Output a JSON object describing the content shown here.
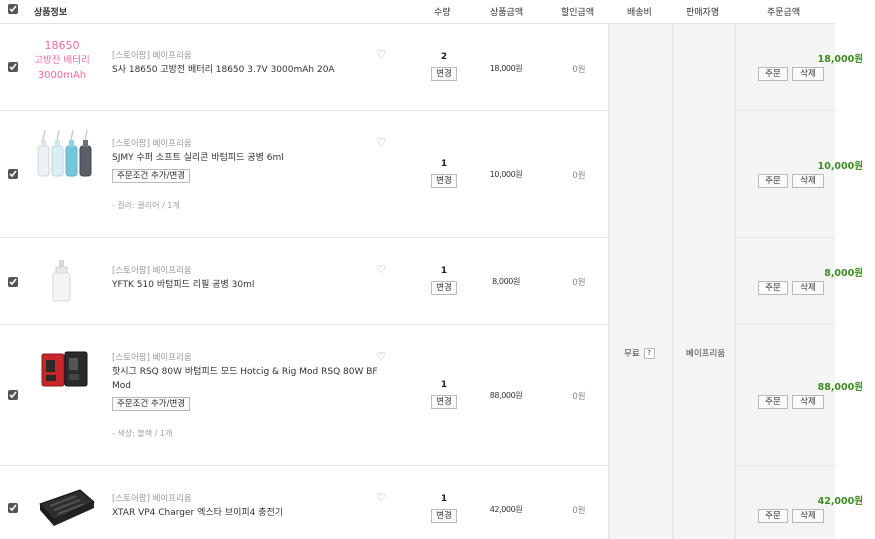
{
  "header": {
    "product_info": "상품정보",
    "quantity": "수량",
    "price": "상품금액",
    "discount": "할인금액",
    "shipping": "배송비",
    "seller": "판매자명",
    "order_total": "주문금액"
  },
  "shipping": {
    "label": "무료",
    "help": "?"
  },
  "seller": {
    "name": "베이프리움"
  },
  "buttons": {
    "change": "변경",
    "order": "주문",
    "delete": "삭제"
  },
  "items": [
    {
      "store": "[스토어팜] 베이프리움",
      "name": "S사 18650 고방전 배터리 18650 3.7V 3000mAh 20A",
      "thumb_lines": [
        "18650",
        "고방전 배터리",
        "3000mAh"
      ],
      "qty": "2",
      "price": "18,000원",
      "discount": "0원",
      "total": "18,000원"
    },
    {
      "store": "[스토어팜] 베이프리움",
      "name": "SJMY 수퍼 소프트 실리콘 바텀피드 공병 6ml",
      "option_button": "주문조건 추가/변경",
      "option_info": "- 컬러: 클리어 / 1개",
      "qty": "1",
      "price": "10,000원",
      "discount": "0원",
      "total": "10,000원"
    },
    {
      "store": "[스토어팜] 베이프리움",
      "name": "YFTK 510 바텀피드 리필 공병 30ml",
      "qty": "1",
      "price": "8,000원",
      "discount": "0원",
      "total": "8,000원"
    },
    {
      "store": "[스토어팜] 베이프리움",
      "name": "핫시그 RSQ 80W 바텀피드 모드 Hotcig & Rig Mod RSQ 80W BF Mod",
      "option_button": "주문조건 추가/변경",
      "option_info": "- 색상: 블랙 / 1개",
      "qty": "1",
      "price": "88,000원",
      "discount": "0원",
      "total": "88,000원"
    },
    {
      "store": "[스토어팜] 베이프리움",
      "name": "XTAR VP4 Charger 엑스타 브이피4 충전기",
      "qty": "1",
      "price": "42,000원",
      "discount": "0원",
      "total": "42,000원"
    }
  ],
  "colors": {
    "total_green": "#3c8c1f",
    "thumb_pink": "#f06b9a"
  }
}
